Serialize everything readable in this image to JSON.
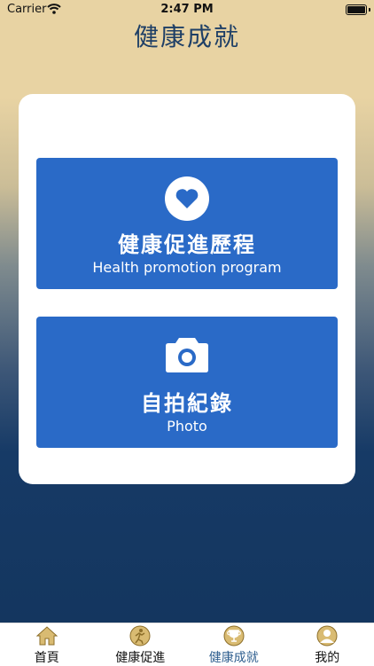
{
  "status_bar": {
    "carrier": "Carrier",
    "time": "2:47 PM"
  },
  "page": {
    "title": "健康成就"
  },
  "menu": [
    {
      "icon": "heart-icon",
      "title": "健康促進歷程",
      "subtitle": "Health promotion program"
    },
    {
      "icon": "camera-icon",
      "title": "自拍紀錄",
      "subtitle": "Photo"
    }
  ],
  "tabbar": {
    "active": 2,
    "items": [
      {
        "label": "首頁",
        "icon": "home-icon"
      },
      {
        "label": "健康促進",
        "icon": "activity-icon"
      },
      {
        "label": "健康成就",
        "icon": "trophy-icon"
      },
      {
        "label": "我的",
        "icon": "user-icon"
      }
    ]
  },
  "colors": {
    "accent": "#2a6ac7",
    "title": "#1e3f66",
    "tab_icon": "#d9bb72"
  }
}
